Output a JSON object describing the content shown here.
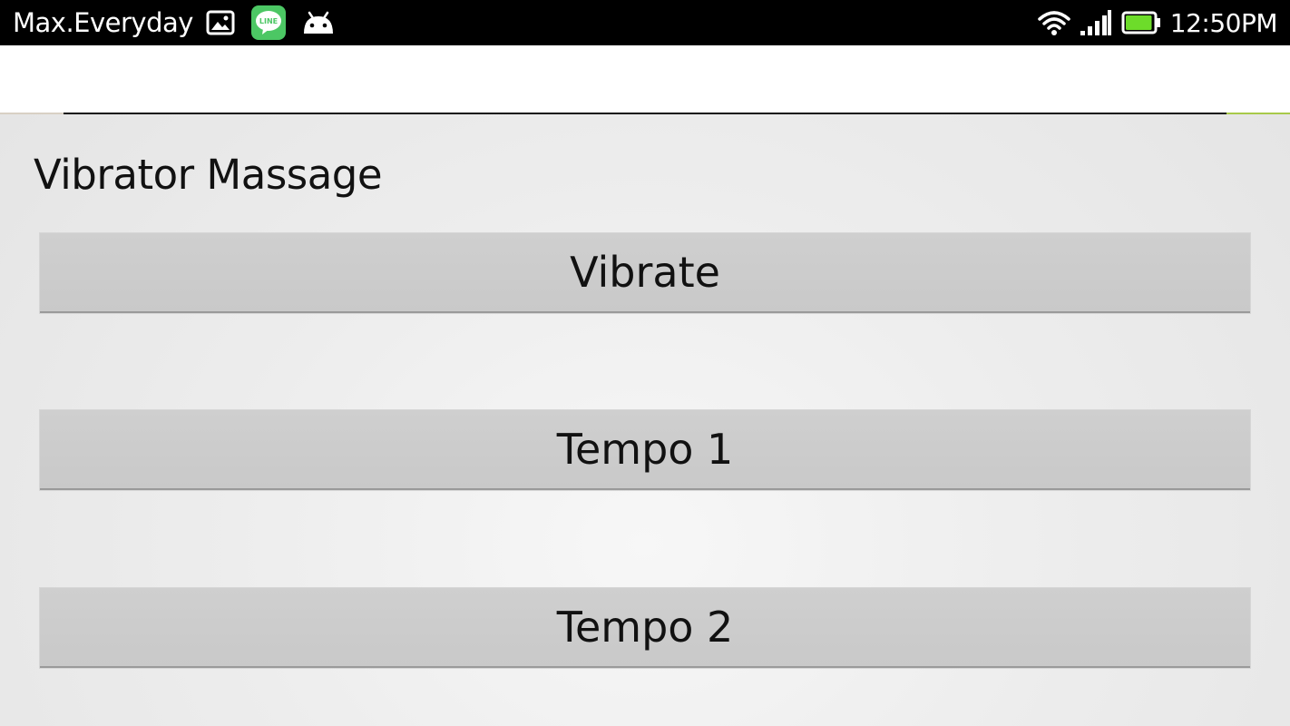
{
  "status_bar": {
    "carrier": "Max.Everyday",
    "notifications": [
      "image-icon",
      "line-app-icon",
      "android-icon"
    ],
    "line_badge_text": "LINE",
    "system_icons": [
      "wifi-icon",
      "signal-icon",
      "battery-icon"
    ],
    "battery_level": 0.95,
    "time": "12:50PM"
  },
  "page": {
    "title": "Vibrator Massage"
  },
  "buttons": {
    "vibrate": "Vibrate",
    "tempo1": "Tempo 1",
    "tempo2": "Tempo 2"
  },
  "colors": {
    "status_bar_bg": "#000000",
    "action_bar_bg": "#ffffff",
    "button_bg": "#cccccc",
    "line_green": "#4cc764",
    "battery_green": "#6ddc2a",
    "accent": "#a8c94a"
  }
}
